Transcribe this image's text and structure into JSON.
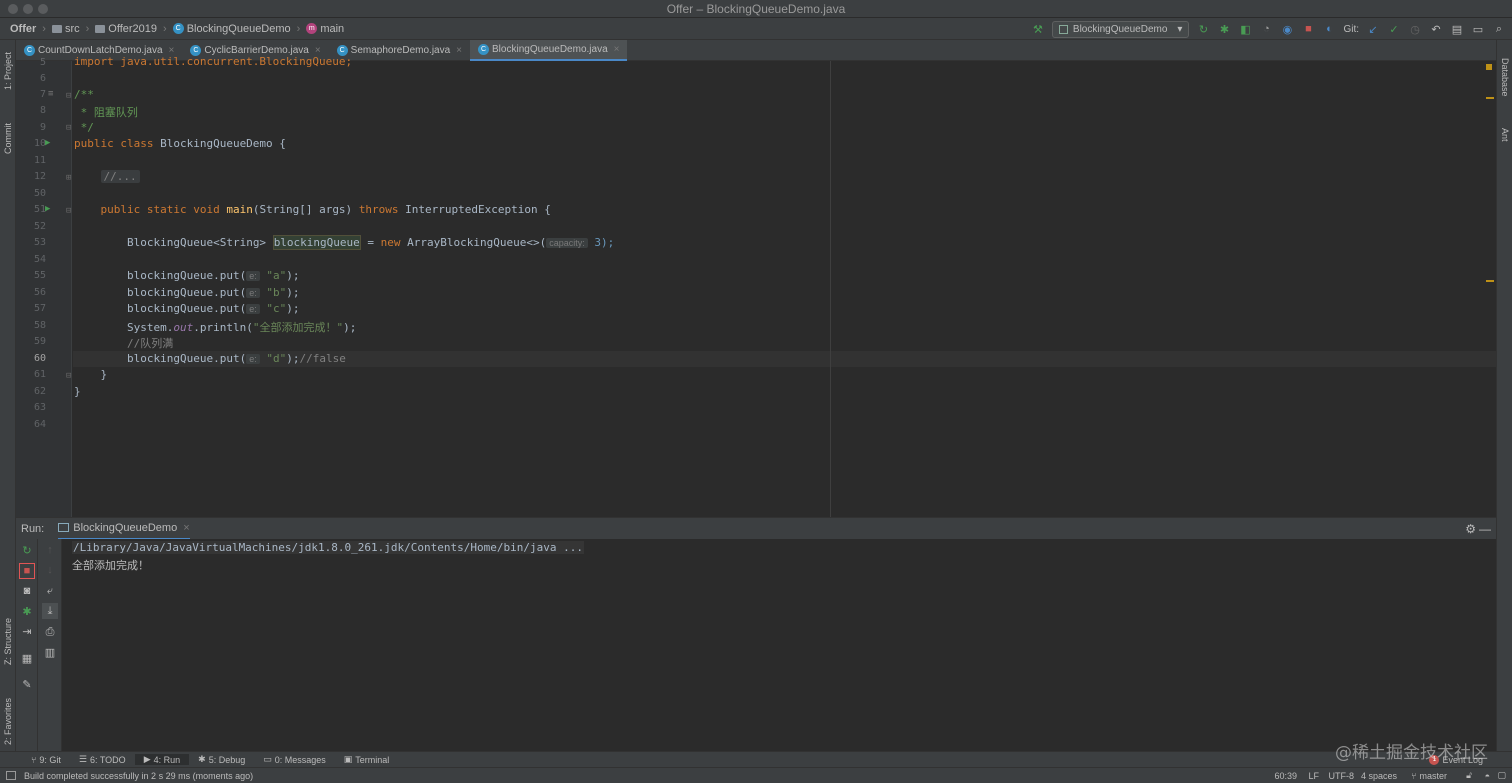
{
  "window": {
    "title": "Offer – BlockingQueueDemo.java"
  },
  "breadcrumb": {
    "items": [
      "Offer",
      "src",
      "Offer2019",
      "BlockingQueueDemo",
      "main"
    ]
  },
  "toolbar": {
    "run_config": "BlockingQueueDemo",
    "git_label": "Git:"
  },
  "left_strip": {
    "project": "1: Project",
    "commit": "Commit",
    "structure": "Z: Structure",
    "favorites": "2: Favorites"
  },
  "right_strip": {
    "database": "Database",
    "ant": "Ant"
  },
  "tabs": [
    {
      "label": "CountDownLatchDemo.java"
    },
    {
      "label": "CyclicBarrierDemo.java"
    },
    {
      "label": "SemaphoreDemo.java"
    },
    {
      "label": "BlockingQueueDemo.java"
    }
  ],
  "editor": {
    "lines": [
      "5",
      "6",
      "7",
      "8",
      "9",
      "10",
      "11",
      "12",
      "50",
      "51",
      "52",
      "53",
      "54",
      "55",
      "56",
      "57",
      "58",
      "59",
      "60",
      "61",
      "62",
      "63",
      "64"
    ],
    "code": {
      "l5_import": "import java.util.concurrent.BlockingQueue;",
      "l7": "/**",
      "l8": " * 阻塞队列",
      "l9": " */",
      "l10_kw": "public class ",
      "l10_name": "BlockingQueueDemo {",
      "l12_fold": "//...",
      "l51_kw": "public static void ",
      "l51_fn": "main",
      "l51_args": "(String[] args) ",
      "l51_throws": "throws ",
      "l51_exc": "InterruptedException {",
      "l53_type": "BlockingQueue<String> ",
      "l53_var": "blockingQueue",
      "l53_eq": " = ",
      "l53_new": "new ",
      "l53_ctor": "ArrayBlockingQueue<>(",
      "l53_hint": "capacity:",
      "l53_end": " 3);",
      "put_call": "blockingQueue.put(",
      "put_hint": "e:",
      "l55_arg": "\"a\"",
      "l56_arg": "\"b\"",
      "l57_arg": "\"c\"",
      "l60_arg": "\"d\"",
      "put_end": ");",
      "l60_comment": "//false",
      "l58_sys": "System.",
      "l58_out": "out",
      "l58_println": ".println(",
      "l58_str": "\"全部添加完成！\"",
      "l58_end": ");",
      "l59": "//队列满",
      "l61": "}",
      "l62": "}"
    }
  },
  "run_panel": {
    "label": "Run:",
    "tab": "BlockingQueueDemo",
    "output": [
      "/Library/Java/JavaVirtualMachines/jdk1.8.0_261.jdk/Contents/Home/bin/java ...",
      "全部添加完成！"
    ]
  },
  "bottom_tabs": [
    {
      "label": "9: Git"
    },
    {
      "label": "6: TODO"
    },
    {
      "label": "4: Run"
    },
    {
      "label": "5: Debug"
    },
    {
      "label": "0: Messages"
    },
    {
      "label": "Terminal"
    }
  ],
  "event_log": {
    "label": "Event Log",
    "count": "1"
  },
  "status": {
    "message": "Build completed successfully in 2 s 29 ms (moments ago)",
    "position": "60:39",
    "line_sep": "LF",
    "encoding": "UTF-8",
    "indent": "4 spaces",
    "branch": "master"
  },
  "watermark": "@稀土掘金技术社区",
  "colors": {
    "keyword": "#cc7832",
    "string": "#6a8759",
    "function": "#ffc66d",
    "comment": "#808080",
    "accent": "#4a88c7",
    "run_green": "#499c54",
    "stop_red": "#c75450"
  }
}
